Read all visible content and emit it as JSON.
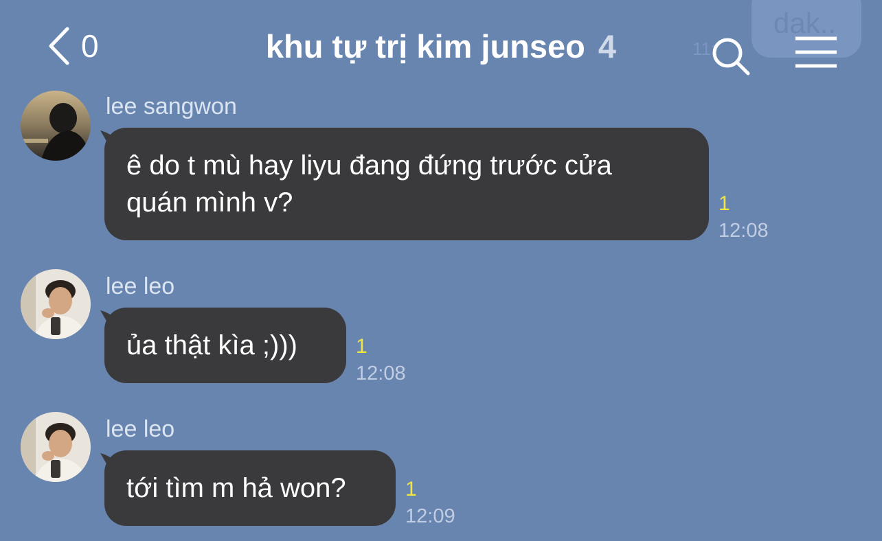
{
  "header": {
    "back_count": "0",
    "title": "khu tự trị kim junseo",
    "member_count": "4"
  },
  "ghost": {
    "text": "dak..",
    "time": "11:"
  },
  "colors": {
    "background": "#6885b0",
    "bubble": "#3a3a3d",
    "unread": "#f3e53f"
  },
  "icons": {
    "back": "chevron-left-icon",
    "search": "search-icon",
    "menu": "hamburger-menu-icon"
  },
  "messages": [
    {
      "sender": "lee sangwon",
      "line1": "ê do t mù hay liyu đang đứng trước cửa",
      "line2": "quán mình v?",
      "unread": "1",
      "time": "12:08"
    },
    {
      "sender": "lee leo",
      "text": "ủa thật kìa ;)))",
      "unread": "1",
      "time": "12:08"
    },
    {
      "sender": "lee leo",
      "text": "tới tìm m hả won?",
      "unread": "1",
      "time": "12:09"
    }
  ]
}
